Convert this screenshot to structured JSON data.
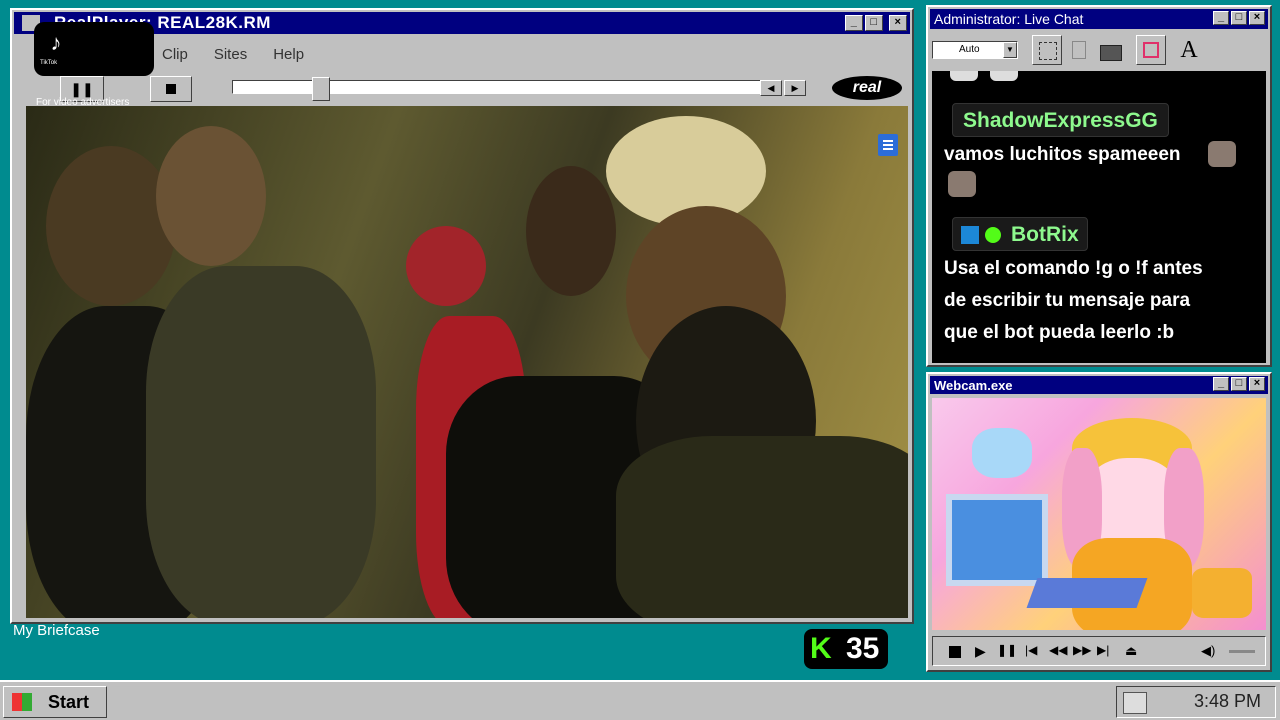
{
  "player": {
    "title": "RealPlayer: REAL28K.RM",
    "menu": [
      "Clip",
      "Sites",
      "Help"
    ],
    "ad_label": "For video advertisers",
    "logo_text": "real",
    "progress": 0.15
  },
  "tiktok": {
    "label": "TikTok"
  },
  "chat": {
    "title": "Administrator: Live Chat",
    "combo_value": "Auto",
    "messages": [
      {
        "user": "ShadowExpressGG",
        "text": "vamos luchitos spameeen"
      },
      {
        "user": "BotRix",
        "lines": [
          "Usa el comando !g o !f antes",
          "de escribir tu mensaje para",
          "que el bot pueda leerlo :b"
        ]
      }
    ]
  },
  "webcam": {
    "title": "Webcam.exe"
  },
  "desktop": {
    "briefcase_label": "My Briefcase",
    "kick_count": "35"
  },
  "taskbar": {
    "start_label": "Start",
    "clock": "3:48 PM"
  },
  "colors": {
    "titlebar": "#000080",
    "desktop": "#008b8f",
    "kick_green": "#53fc18",
    "chat_name": "#8ef98e"
  }
}
